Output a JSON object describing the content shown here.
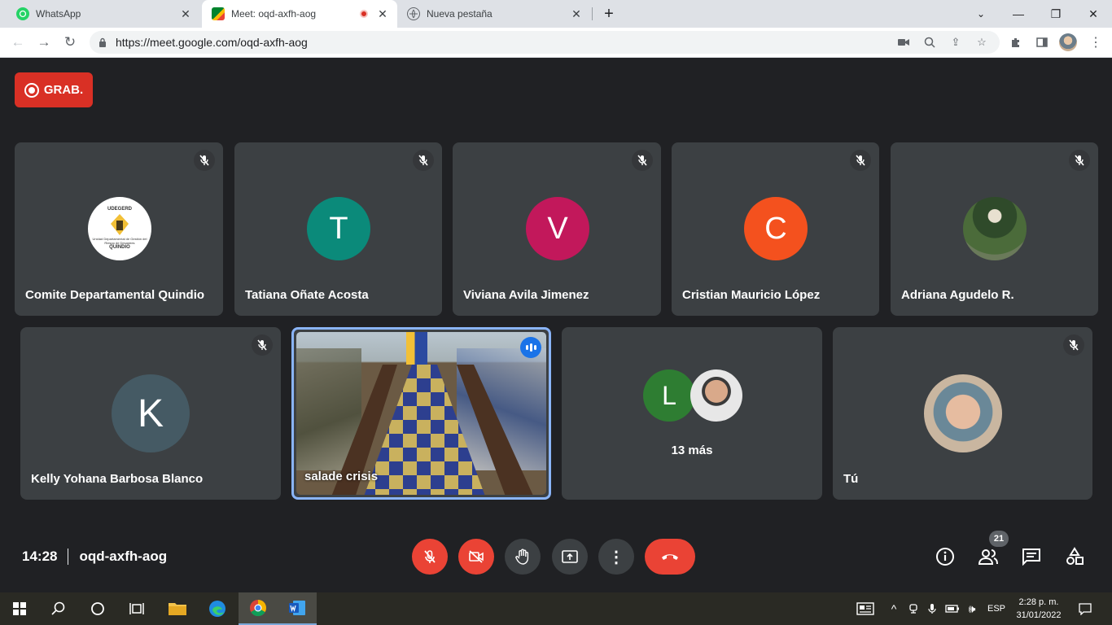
{
  "browser": {
    "tabs": [
      {
        "title": "WhatsApp",
        "active": false
      },
      {
        "title": "Meet: oqd-axfh-aog",
        "active": true,
        "recording": true
      },
      {
        "title": "Nueva pestaña",
        "active": false
      }
    ],
    "url": "https://meet.google.com/oqd-axfh-aog"
  },
  "meet": {
    "recording_label": "GRAB.",
    "participants_row1": [
      {
        "name": "Comite Departamental Quindio",
        "avatar_type": "logo",
        "logo_top": "UDEGERD",
        "logo_mid": "Unidad Departamental de Gestión del Riesgo de Desastres",
        "logo_bottom": "QUINDIO"
      },
      {
        "name": "Tatiana Oñate Acosta",
        "initial": "T",
        "color": "#0b8a7a"
      },
      {
        "name": "Viviana Avila Jimenez",
        "initial": "V",
        "color": "#c2185b"
      },
      {
        "name": "Cristian Mauricio López",
        "initial": "C",
        "color": "#f4511e"
      },
      {
        "name": "Adriana Agudelo R.",
        "avatar_type": "photo"
      }
    ],
    "participants_row2": [
      {
        "name": "Kelly Yohana Barbosa Blanco",
        "initial": "K",
        "color": "#455a64"
      },
      {
        "name": "salade crisis",
        "avatar_type": "video"
      },
      {
        "name": "13 más",
        "initial": "L",
        "color": "#2e7d32"
      },
      {
        "name": "Tú",
        "avatar_type": "photo"
      }
    ],
    "time": "14:28",
    "meeting_code": "oqd-axfh-aog",
    "participant_count": "21"
  },
  "taskbar": {
    "language": "ESP",
    "time": "2:28 p. m.",
    "date": "31/01/2022"
  }
}
